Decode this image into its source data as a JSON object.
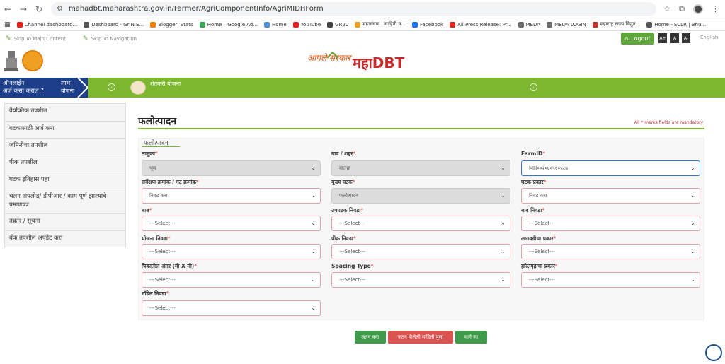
{
  "browser": {
    "url": "mahadbt.maharashtra.gov.in/Farmer/AgriComponentInfo/AgriMIDHForm",
    "bookmarks": [
      {
        "label": "Channel dashboard...",
        "color": "#e62117"
      },
      {
        "label": "Dashboard - Gr N S...",
        "color": "#555555"
      },
      {
        "label": "Blogger: Stats",
        "color": "#f57d00"
      },
      {
        "label": "Home – Google Ad...",
        "color": "#34a853"
      },
      {
        "label": "Home",
        "color": "#4a90d9"
      },
      {
        "label": "YouTube",
        "color": "#e62117"
      },
      {
        "label": "GR20",
        "color": "#444444"
      },
      {
        "label": "महासंवाद | माहिती व...",
        "color": "#f0a020"
      },
      {
        "label": "Facebook",
        "color": "#1877f2"
      },
      {
        "label": "All Press Release: Pr...",
        "color": "#e62117"
      },
      {
        "label": "MEDA",
        "color": "#6b6b6b"
      },
      {
        "label": "MEDA LOGIN",
        "color": "#6b6b6b"
      },
      {
        "label": "महाराष्ट्र राज्य विद्युत...",
        "color": "#c4302b"
      },
      {
        "label": "Home - SCLR | Bhu...",
        "color": "#555555"
      }
    ]
  },
  "topbar": {
    "skip_main": "Skip To Main Content",
    "skip_nav": "Skip To Navigation",
    "logout": "Logout",
    "font_increase": "A+",
    "font_normal": "A",
    "font_decrease": "A-",
    "language": "English"
  },
  "header": {
    "brand_left": "आपले सरकार",
    "brand_right": "महाDBT"
  },
  "nav": {
    "online_line1": "ऑनलाईन",
    "online_line2": "अर्ज कसा कराल ?",
    "labh_line1": "लाभ",
    "labh_line2": "योजना",
    "sheti": "शेतकरी योजना",
    "colors": {
      "green": "#7cb72f",
      "blue": "#1d3f8a"
    }
  },
  "sidebar": {
    "items": [
      "वैयक्तिक तपशील",
      "घटकासाठी अर्ज करा",
      "जमिनीचा तपशील",
      "पीक तपशील",
      "घटक इतिहास पहा",
      "चलन अपलोड/ डीपीआर / काम पूर्ण झाल्याचे प्रमाणपत्र",
      "तक्रार / सूचना",
      "बँक तपशील अपडेट करा"
    ]
  },
  "main": {
    "title": "फलोत्पादन",
    "mandatory_note": "All * marks fields are mandatory",
    "section_legend": "फलोत्पादन",
    "fields": {
      "taluka": {
        "label": "तालुका",
        "value": "भूम"
      },
      "gaon": {
        "label": "गाव / शहर",
        "value": "वालहा"
      },
      "farmid": {
        "label": "FarmID",
        "value": "MH००२०७०५१०५८७"
      },
      "survey": {
        "label": "सर्वेक्षण क्रमांक / गट क्रमांक",
        "value": "निवड करा"
      },
      "mukhya": {
        "label": "मुख्य घटक",
        "value": "फलोत्पादन"
      },
      "ghatak_prakar": {
        "label": "घटक प्रकार",
        "value": "निवड करा"
      },
      "bab": {
        "label": "बाब",
        "value": "---Select---"
      },
      "upghatak": {
        "label": "उपघटक निवडा",
        "value": "---Select---"
      },
      "bab_nivda": {
        "label": "बाब निवडा",
        "value": "---Select---"
      },
      "yojana": {
        "label": "योजना निवडा",
        "value": "---Select---"
      },
      "peek": {
        "label": "पीक निवडा",
        "value": "---Select---"
      },
      "lagvad": {
        "label": "लागवडीचा प्रकार",
        "value": "---Select---"
      },
      "pikatil": {
        "label": "पिकातील अंतर (मी X मी)",
        "value": "---Select---"
      },
      "spacing": {
        "label": "Spacing Type",
        "value": "---Select---"
      },
      "haritgruh": {
        "label": "हरितगृहाचा प्रकार",
        "value": "---Select---"
      },
      "model": {
        "label": "मॉडेल निवडा",
        "value": "---Select---"
      }
    },
    "buttons": {
      "add": "जतन करा",
      "saved": "जतन केलेली माहिती पुसा",
      "back": "मागे जा"
    }
  }
}
